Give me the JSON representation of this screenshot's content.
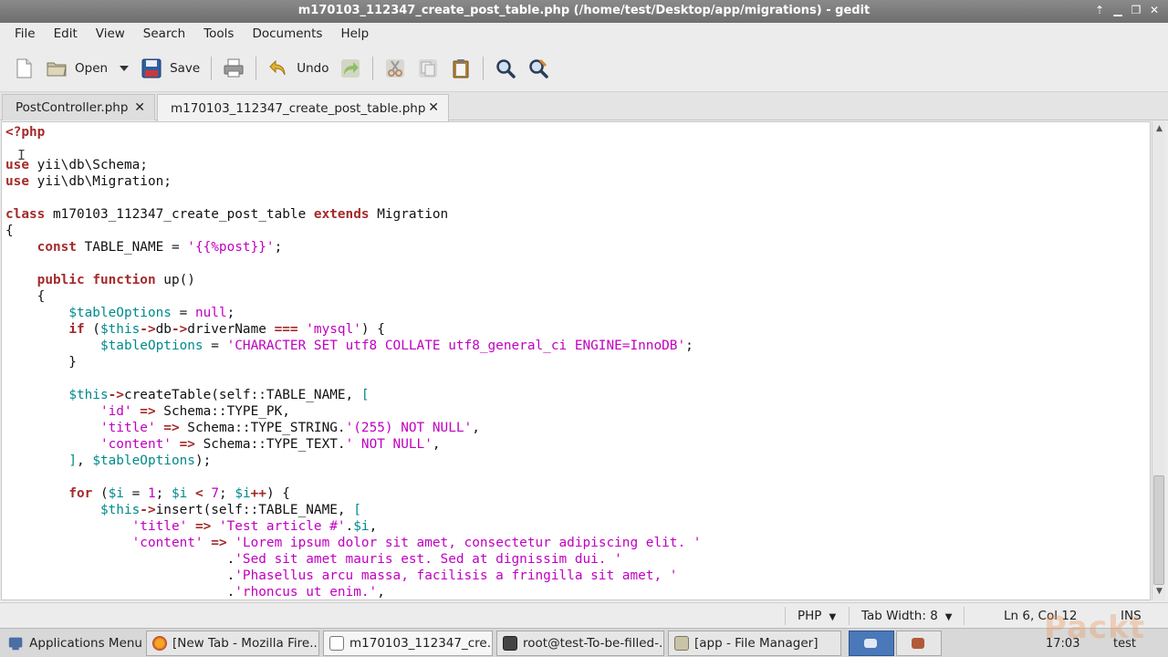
{
  "window": {
    "title": "m170103_112347_create_post_table.php (/home/test/Desktop/app/migrations) - gedit"
  },
  "menu": [
    "File",
    "Edit",
    "View",
    "Search",
    "Tools",
    "Documents",
    "Help"
  ],
  "toolbar": {
    "open_label": "Open",
    "save_label": "Save",
    "undo_label": "Undo"
  },
  "tabs": [
    {
      "label": "PostController.php",
      "close": "✕"
    },
    {
      "label": "m170103_112347_create_post_table.php",
      "close": "✕"
    }
  ],
  "status": {
    "language": "PHP",
    "tab_width": "Tab Width: 8",
    "position": "Ln 6, Col 12",
    "mode": "INS"
  },
  "taskbar": {
    "apps_menu": "Applications Menu",
    "tasks": [
      "[New Tab - Mozilla Fire...",
      "m170103_112347_cre...",
      "root@test-To-be-filled-...",
      "[app - File Manager]"
    ],
    "clock": "17:03",
    "user": "test"
  },
  "watermark": "Packt",
  "colors": {
    "keyword": "#a52a2a",
    "variable": "#008a8c",
    "string": "#c000c0"
  }
}
